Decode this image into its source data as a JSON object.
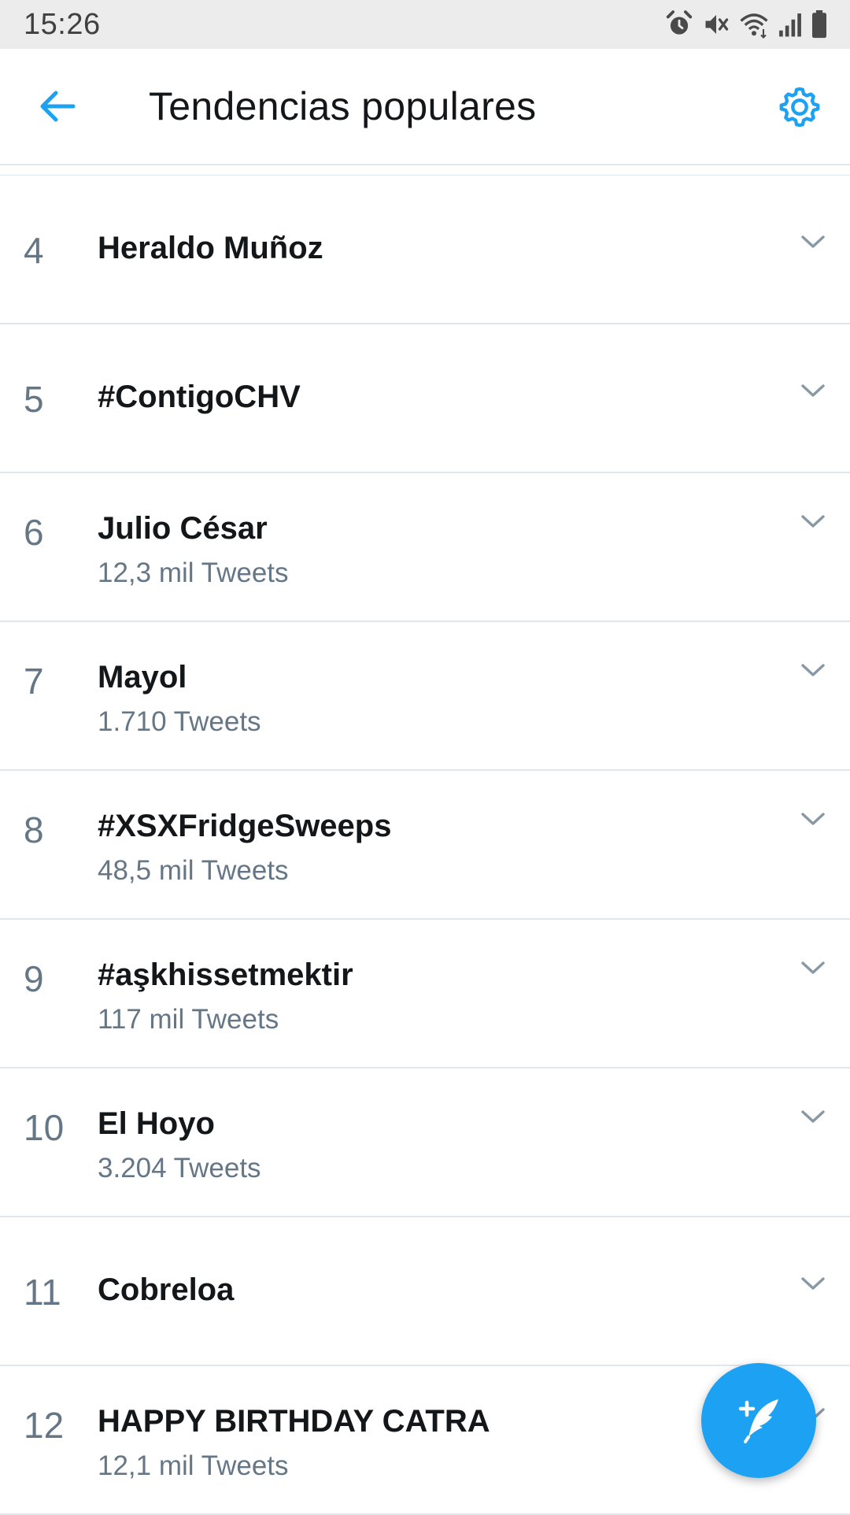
{
  "status_bar": {
    "time": "15:26",
    "icons": [
      "alarm-icon",
      "mute-icon",
      "wifi-icon",
      "signal-icon",
      "battery-icon"
    ]
  },
  "header": {
    "title": "Tendencias populares",
    "back_icon": "arrow-left-icon",
    "settings_icon": "gear-icon"
  },
  "colors": {
    "accent": "#1da1f2",
    "text_primary": "#14171a",
    "text_secondary": "#657786",
    "divider": "#e1e8ed"
  },
  "trends": [
    {
      "rank": "4",
      "name": "Heraldo Muñoz",
      "count": ""
    },
    {
      "rank": "5",
      "name": "#ContigoCHV",
      "count": ""
    },
    {
      "rank": "6",
      "name": "Julio César",
      "count": "12,3 mil Tweets"
    },
    {
      "rank": "7",
      "name": "Mayol",
      "count": "1.710 Tweets"
    },
    {
      "rank": "8",
      "name": "#XSXFridgeSweeps",
      "count": "48,5 mil Tweets"
    },
    {
      "rank": "9",
      "name": "#aşkhissetmektir",
      "count": "117 mil Tweets"
    },
    {
      "rank": "10",
      "name": "El Hoyo",
      "count": "3.204 Tweets"
    },
    {
      "rank": "11",
      "name": "Cobreloa",
      "count": ""
    },
    {
      "rank": "12",
      "name": "HAPPY BIRTHDAY CATRA",
      "count": "12,1 mil Tweets"
    }
  ],
  "fab": {
    "icon": "compose-tweet-icon"
  }
}
